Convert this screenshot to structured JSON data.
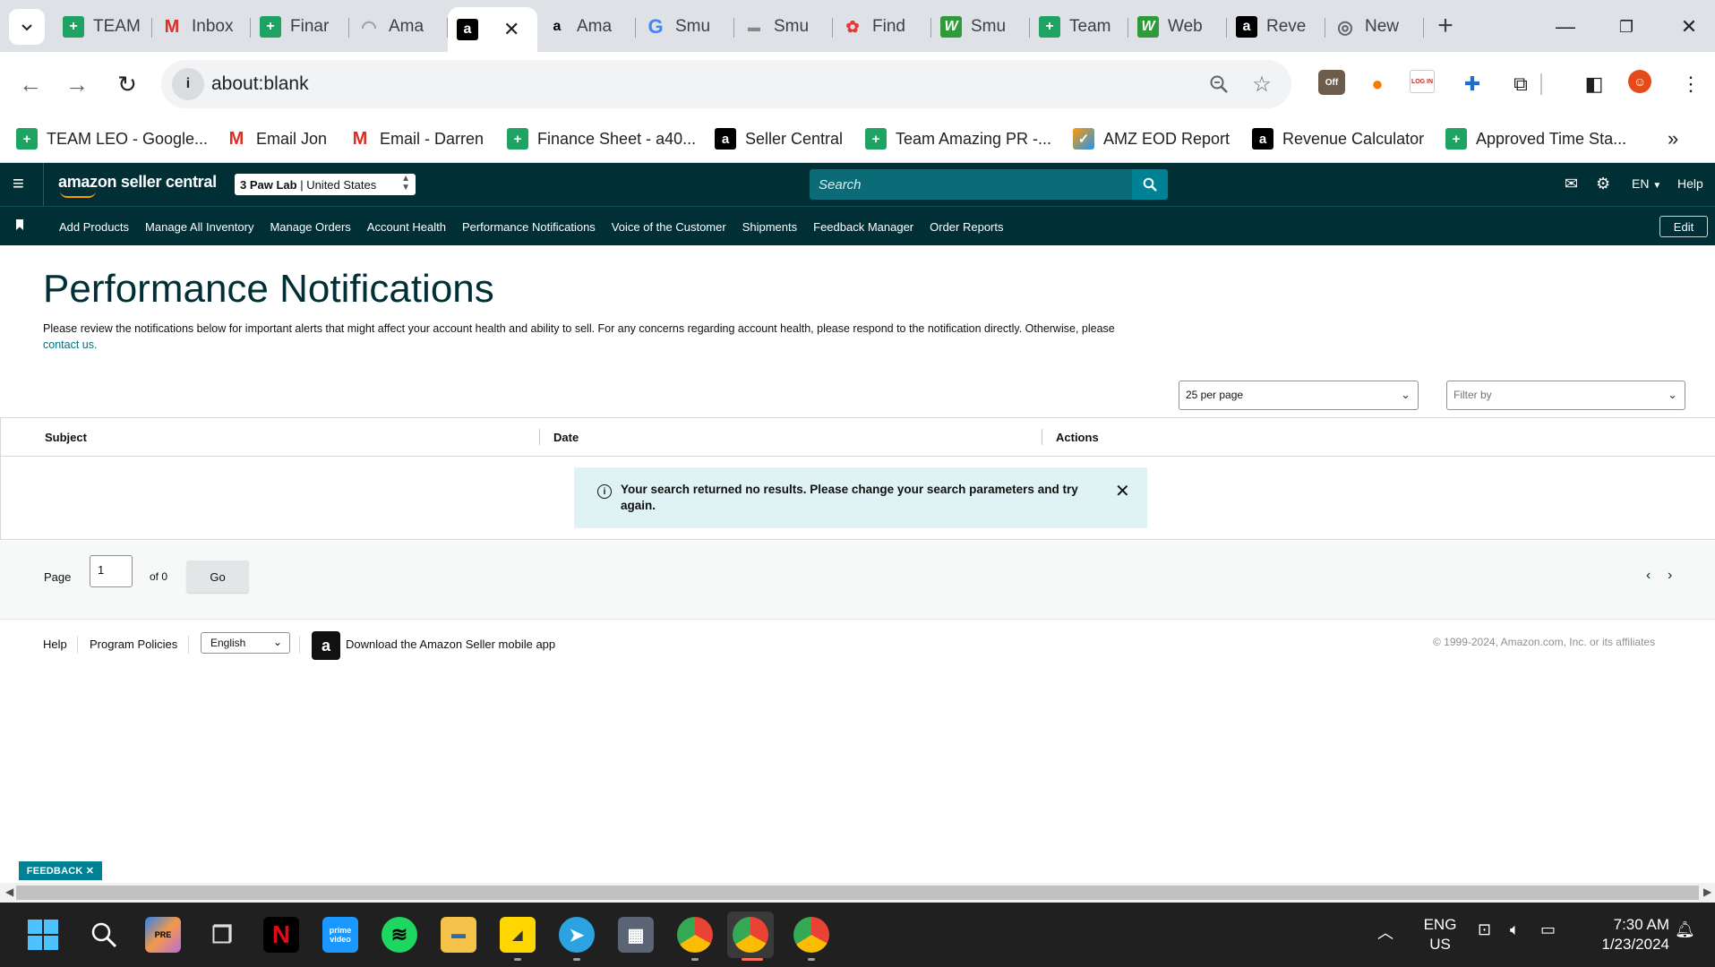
{
  "browser": {
    "tabs": [
      {
        "title": "TEAM",
        "favicon": "sheets-icon"
      },
      {
        "title": "Inbox",
        "favicon": "gmail-icon"
      },
      {
        "title": "Finar",
        "favicon": "sheets-icon"
      },
      {
        "title": "Ama",
        "favicon": "loading-spinner-icon"
      },
      {
        "title": "",
        "favicon": "amazon-icon",
        "active": true
      },
      {
        "title": "Ama",
        "favicon": "amazon-small-icon"
      },
      {
        "title": "Smu",
        "favicon": "google-icon"
      },
      {
        "title": "Smu",
        "favicon": "smuggler-icon"
      },
      {
        "title": "Find",
        "favicon": "photos-icon"
      },
      {
        "title": "Smu",
        "favicon": "wv-icon"
      },
      {
        "title": "Team",
        "favicon": "sheets-icon"
      },
      {
        "title": "Web",
        "favicon": "wv-icon"
      },
      {
        "title": "Reve",
        "favicon": "amazon-icon"
      },
      {
        "title": "New",
        "favicon": "chrome-icon"
      }
    ],
    "url": "about:blank",
    "bookmarks": [
      {
        "label": "TEAM LEO - Google...",
        "favicon": "sheets-icon"
      },
      {
        "label": "Email Jon",
        "favicon": "gmail-icon"
      },
      {
        "label": "Email - Darren",
        "favicon": "gmail-icon"
      },
      {
        "label": "Finance Sheet - a40...",
        "favicon": "sheets-icon"
      },
      {
        "label": "Seller Central",
        "favicon": "amazon-icon"
      },
      {
        "label": "Team Amazing PR -...",
        "favicon": "sheets-icon"
      },
      {
        "label": "AMZ EOD Report",
        "favicon": "report-icon"
      },
      {
        "label": "Revenue Calculator",
        "favicon": "amazon-icon"
      },
      {
        "label": "Approved Time Sta...",
        "favicon": "sheets-icon"
      }
    ],
    "extension_off_label": "Off",
    "extension_login_label": "LOG IN"
  },
  "seller_central": {
    "logo": "amazon seller central",
    "account_store": "3 Paw Lab",
    "account_region": "United States",
    "search_placeholder": "Search",
    "language": "EN",
    "help": "Help",
    "nav": [
      "Add Products",
      "Manage All Inventory",
      "Manage Orders",
      "Account Health",
      "Performance Notifications",
      "Voice of the Customer",
      "Shipments",
      "Feedback Manager",
      "Order Reports"
    ],
    "edit": "Edit"
  },
  "page": {
    "title": "Performance Notifications",
    "description": "Please review the notifications below for important alerts that might affect your account health and ability to sell. For any concerns regarding account health, please respond to the notification directly. Otherwise, please",
    "contact_link": "contact us.",
    "per_page": "25 per page",
    "filter_placeholder": "Filter by",
    "columns": [
      "Subject",
      "Date",
      "Actions"
    ],
    "no_results": "Your search returned no results. Please change your search parameters and try again.",
    "pager": {
      "label": "Page",
      "value": "1",
      "of": "of 0",
      "go": "Go"
    }
  },
  "footer": {
    "help": "Help",
    "policies": "Program Policies",
    "language": "English",
    "app": "Download the Amazon Seller mobile app",
    "copyright": "© 1999-2024, Amazon.com, Inc. or its affiliates"
  },
  "feedback": "FEEDBACK",
  "taskbar": {
    "lang_line1": "ENG",
    "lang_line2": "US",
    "time": "7:30 AM",
    "date": "1/23/2024"
  },
  "colors": {
    "sc_header": "#002f36",
    "sc_search": "#0b6b77",
    "accent": "#008296",
    "alert_bg": "#dff2f4",
    "link": "#007185"
  }
}
